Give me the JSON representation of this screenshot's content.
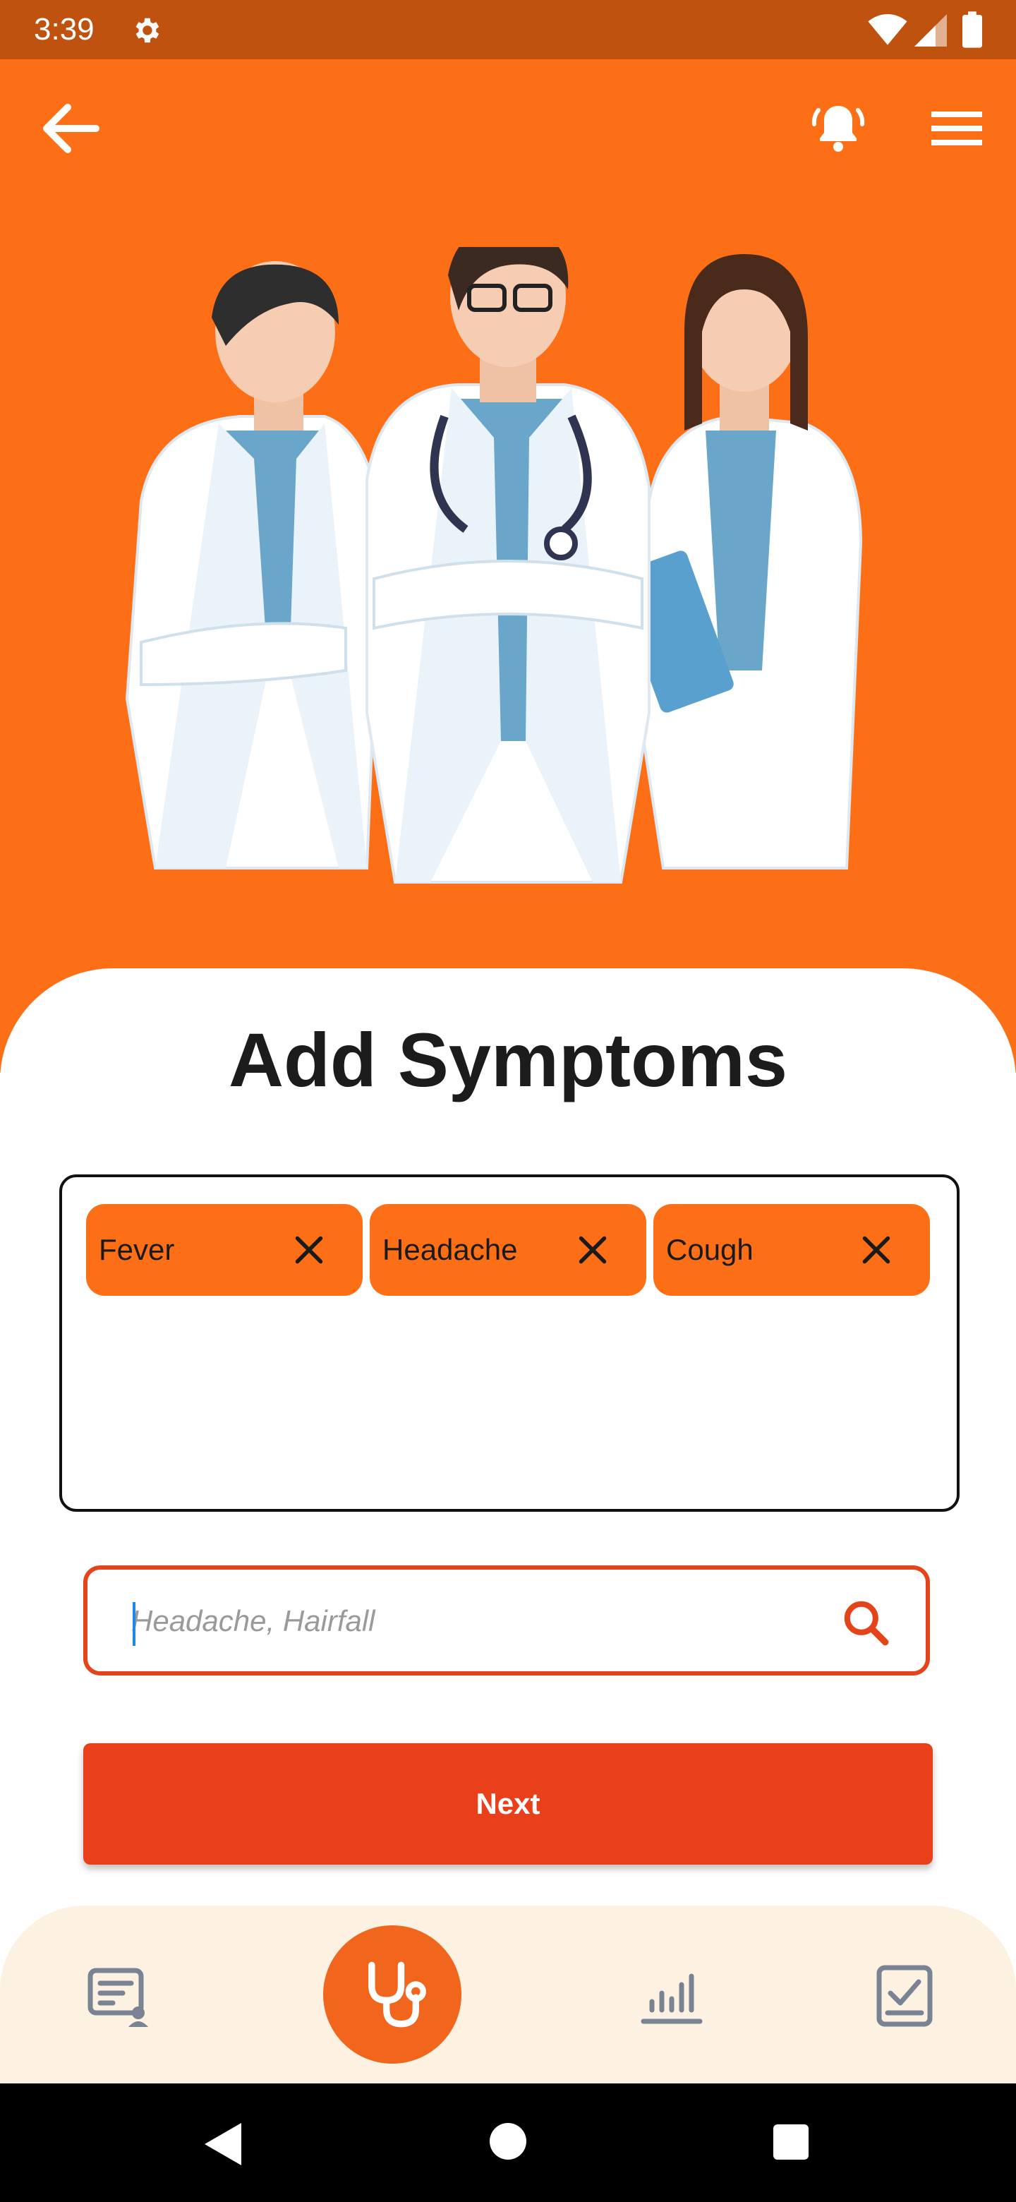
{
  "status_bar": {
    "time": "3:39",
    "icons": [
      "gear-icon",
      "wifi-icon",
      "signal-icon",
      "battery-icon"
    ]
  },
  "top_bar": {
    "icons": [
      "back-arrow-icon",
      "bell-ringing-icon",
      "menu-icon"
    ]
  },
  "illustration": {
    "name": "three-doctors-illustration"
  },
  "page": {
    "title": "Add Symptoms"
  },
  "symptoms": {
    "chips": [
      {
        "label": "Fever"
      },
      {
        "label": "Headache"
      },
      {
        "label": "Cough"
      }
    ]
  },
  "search": {
    "value": "",
    "placeholder": "Headache, Hairfall"
  },
  "actions": {
    "next_label": "Next"
  },
  "bottom_nav": {
    "items": [
      {
        "name": "report-icon"
      },
      {
        "name": "stethoscope-icon",
        "active": true
      },
      {
        "name": "chart-icon"
      },
      {
        "name": "checklist-icon"
      }
    ]
  },
  "colors": {
    "status_bar": "#bf520e",
    "hero": "#fd6f16",
    "chip": "#fd6f16",
    "accent": "#e8401a",
    "nav_bg": "#fdf1e2"
  }
}
